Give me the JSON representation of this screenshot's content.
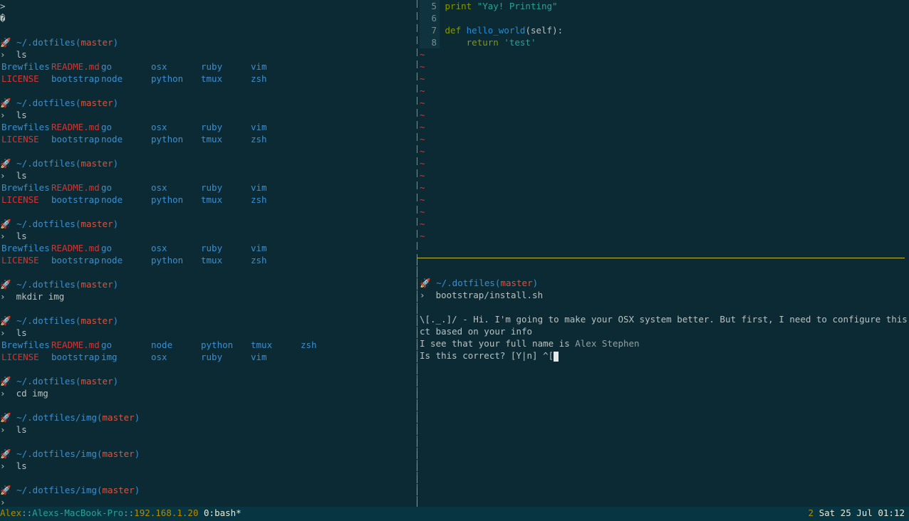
{
  "left_pane": {
    "top_lines": [
      ">",
      "�"
    ],
    "prompt_icon": "rocket-icon",
    "blocks": [
      {
        "path": "~/.dotfiles",
        "branch": "master",
        "command": "ls",
        "rows": [
          [
            "Brewfiles",
            "README.md",
            "go",
            "osx",
            "ruby",
            "vim"
          ],
          [
            "LICENSE",
            "bootstrap",
            "node",
            "python",
            "tmux",
            "zsh"
          ]
        ]
      },
      {
        "path": "~/.dotfiles",
        "branch": "master",
        "command": "ls",
        "rows": [
          [
            "Brewfiles",
            "README.md",
            "go",
            "osx",
            "ruby",
            "vim"
          ],
          [
            "LICENSE",
            "bootstrap",
            "node",
            "python",
            "tmux",
            "zsh"
          ]
        ]
      },
      {
        "path": "~/.dotfiles",
        "branch": "master",
        "command": "ls",
        "rows": [
          [
            "Brewfiles",
            "README.md",
            "go",
            "osx",
            "ruby",
            "vim"
          ],
          [
            "LICENSE",
            "bootstrap",
            "node",
            "python",
            "tmux",
            "zsh"
          ]
        ]
      },
      {
        "path": "~/.dotfiles",
        "branch": "master",
        "command": "ls",
        "rows": [
          [
            "Brewfiles",
            "README.md",
            "go",
            "osx",
            "ruby",
            "vim"
          ],
          [
            "LICENSE",
            "bootstrap",
            "node",
            "python",
            "tmux",
            "zsh"
          ]
        ]
      },
      {
        "path": "~/.dotfiles",
        "branch": "master",
        "command": "mkdir img",
        "rows": []
      },
      {
        "path": "~/.dotfiles",
        "branch": "master",
        "command": "ls",
        "rows": [
          [
            "Brewfiles",
            "README.md",
            "go",
            "node",
            "python",
            "tmux",
            "zsh"
          ],
          [
            "LICENSE",
            "bootstrap",
            "img",
            "osx",
            "ruby",
            "vim"
          ]
        ]
      },
      {
        "path": "~/.dotfiles",
        "branch": "master",
        "command": "cd img",
        "rows": []
      },
      {
        "path": "~/.dotfiles/img",
        "branch": "master",
        "command": "ls",
        "rows": []
      },
      {
        "path": "~/.dotfiles/img",
        "branch": "master",
        "command": "ls",
        "rows": []
      },
      {
        "path": "~/.dotfiles/img",
        "branch": "master",
        "command": "",
        "rows": []
      }
    ]
  },
  "vim_pane": {
    "lines": [
      {
        "num": "5",
        "code": "print \"Yay! Printing\""
      },
      {
        "num": "6",
        "code": ""
      },
      {
        "num": "7",
        "code": "def hello_world(self):"
      },
      {
        "num": "8",
        "code": "    return 'test'"
      }
    ],
    "tilde": "~",
    "tilde_count": 16
  },
  "install_pane": {
    "path": "~/.dotfiles",
    "branch": "master",
    "command": "bootstrap/install.sh",
    "msg1": "\\[._.]/ - Hi. I'm going to make your OSX system better. But first, I need to configure this proje",
    "msg2": "ct based on your info",
    "msg3_prefix": "I see that your full name is ",
    "msg3_name": "Alex Stephen",
    "msg4": "Is this correct? [Y|n] ^["
  },
  "status_bar": {
    "user": "Alex",
    "sep1": "::",
    "host": "Alexs-MacBook-Pro",
    "sep2": "::",
    "ip": "192.168.1.20",
    "window": "0:bash*",
    "right_num": "2",
    "datetime": "Sat 25 Jul 01:12"
  }
}
